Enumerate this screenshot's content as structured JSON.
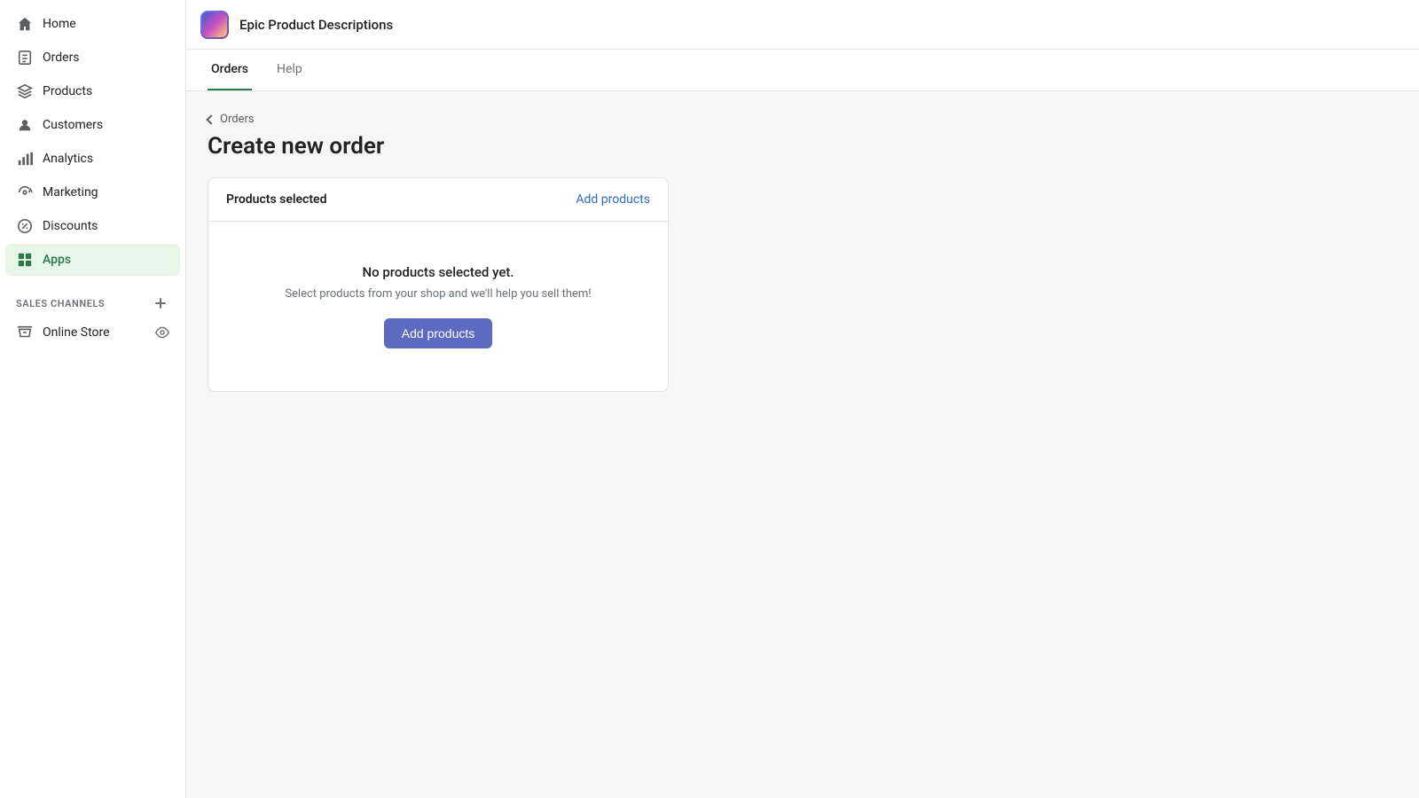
{
  "sidebar": {
    "nav_items": [
      {
        "id": "home",
        "label": "Home",
        "icon": "home-icon"
      },
      {
        "id": "orders",
        "label": "Orders",
        "icon": "orders-icon"
      },
      {
        "id": "products",
        "label": "Products",
        "icon": "products-icon"
      },
      {
        "id": "customers",
        "label": "Customers",
        "icon": "customers-icon"
      },
      {
        "id": "analytics",
        "label": "Analytics",
        "icon": "analytics-icon"
      },
      {
        "id": "marketing",
        "label": "Marketing",
        "icon": "marketing-icon"
      },
      {
        "id": "discounts",
        "label": "Discounts",
        "icon": "discounts-icon"
      },
      {
        "id": "apps",
        "label": "Apps",
        "icon": "apps-icon",
        "active": true
      }
    ],
    "sales_channels_label": "SALES CHANNELS",
    "online_store_label": "Online Store"
  },
  "topbar": {
    "app_title": "Epic Product Descriptions"
  },
  "tabs": [
    {
      "id": "orders",
      "label": "Orders",
      "active": true
    },
    {
      "id": "help",
      "label": "Help",
      "active": false
    }
  ],
  "breadcrumb": {
    "label": "Orders"
  },
  "page": {
    "title": "Create new order"
  },
  "card": {
    "header_title": "Products selected",
    "add_products_link": "Add products",
    "empty_title": "No products selected yet.",
    "empty_desc": "Select products from your shop and we'll help you sell them!",
    "add_products_btn": "Add products"
  }
}
